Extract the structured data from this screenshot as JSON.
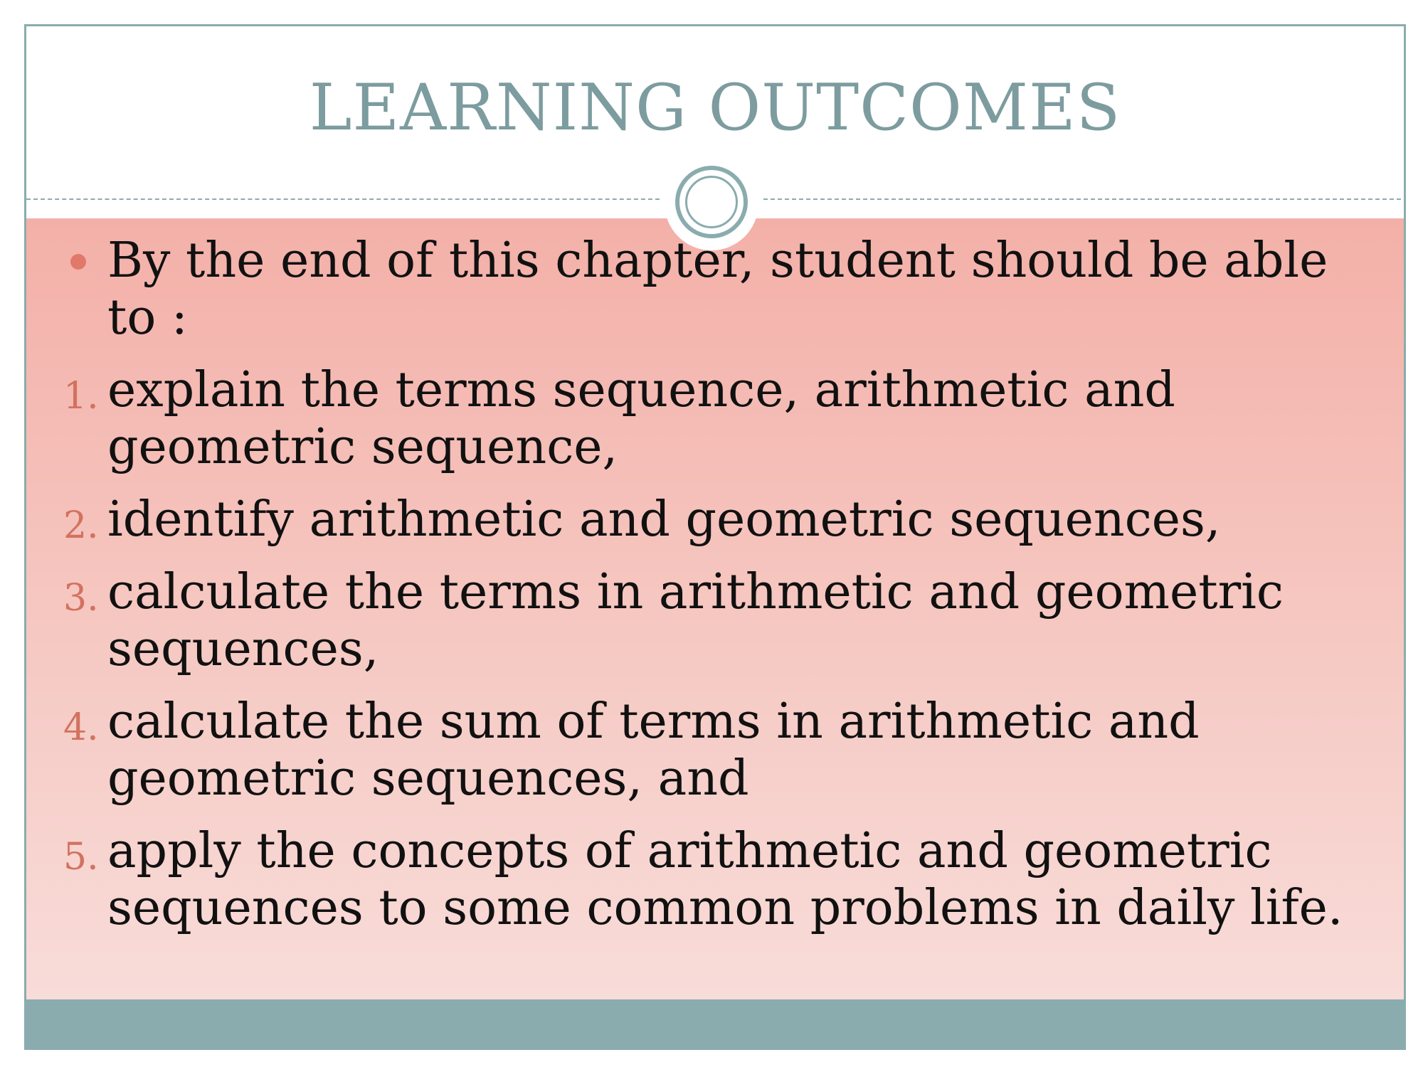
{
  "slide": {
    "title": "LEARNING OUTCOMES",
    "intro": "By the end of this chapter, student should be able to :",
    "outcomes": [
      {
        "number": "1.",
        "text": "explain the terms sequence, arithmetic and geometric sequence,"
      },
      {
        "number": "2.",
        "text": "identify arithmetic and geometric sequences,"
      },
      {
        "number": "3.",
        "text": "calculate the terms in arithmetic and geometric sequences,"
      },
      {
        "number": "4.",
        "text": "calculate the sum of terms in arithmetic and geometric sequences, and"
      },
      {
        "number": "5.",
        "text": "apply the concepts of arithmetic and geometric sequences to some common problems in daily life."
      }
    ]
  },
  "colors": {
    "title": "#7d9c9f",
    "accent_teal": "#8aacae",
    "bullet": "#e0796a",
    "number": "#d2725f",
    "content_top": "#f3b0a8",
    "content_bottom": "#f8dcd9",
    "text": "#111111"
  },
  "icons": {
    "bullet": "bullet-dot-icon",
    "ornament": "ring-ornament-icon"
  }
}
